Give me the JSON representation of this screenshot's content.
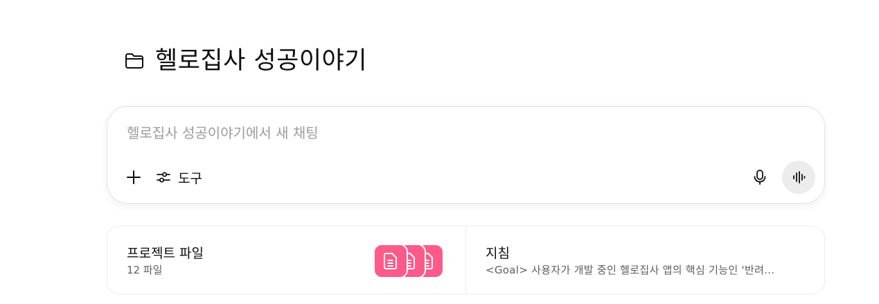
{
  "project": {
    "icon": "folder-icon",
    "title": "헬로집사 성공이야기"
  },
  "composer": {
    "placeholder": "헬로집사 성공이야기에서 새 채팅",
    "value": "",
    "plus_icon": "plus-icon",
    "tools_icon": "sliders-icon",
    "tools_label": "도구",
    "mic_icon": "microphone-icon",
    "voice_icon": "voice-waveform-icon"
  },
  "cards": {
    "files": {
      "title": "프로젝트 파일",
      "subtitle": "12 파일",
      "file_icon": "document-icon",
      "tile_color": "#ff5a8a"
    },
    "instructions": {
      "title": "지침",
      "preview": "<Goal> 사용자가 개발 중인 헬로집사 앱의 핵심 기능인 '반려..."
    }
  }
}
